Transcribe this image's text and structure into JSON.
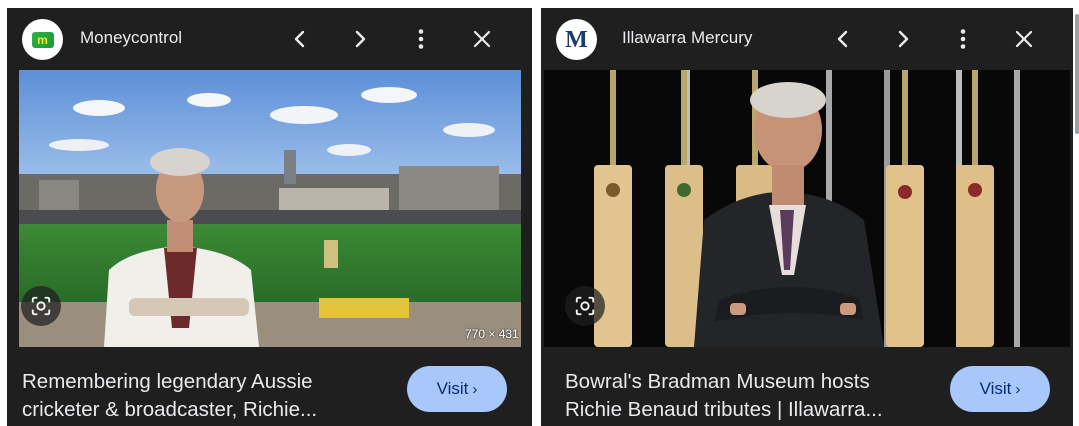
{
  "cards": [
    {
      "source": "Moneycontrol",
      "logo_icon": "moneycontrol-logo-icon",
      "logo_text": "m",
      "image_dims": "770 × 431",
      "caption_line1": "Remembering legendary Aussie",
      "caption_line2": "cricketer & broadcaster, Richie...",
      "visit_label": "Visit"
    },
    {
      "source": "Illawarra Mercury",
      "logo_icon": "illawarra-mercury-logo-icon",
      "logo_text": "M",
      "caption_line1": "Bowral's Bradman Museum hosts",
      "caption_line2": "Richie Benaud tributes | Illawarra...",
      "visit_label": "Visit"
    }
  ],
  "header_icons": [
    "chevron-left-icon",
    "chevron-right-icon",
    "more-vert-icon",
    "close-icon"
  ],
  "colors": {
    "panel_bg": "#1f1f1f",
    "visit_bg": "#a8c7fa",
    "visit_text": "#062e6f",
    "caption_text": "#e8eaed"
  }
}
